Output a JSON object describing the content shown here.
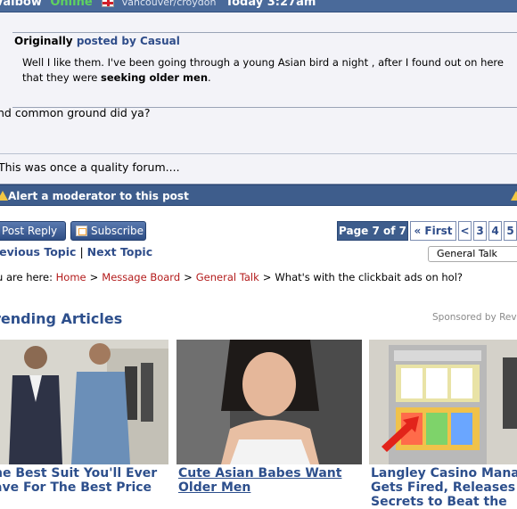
{
  "header": {
    "username": "Valbow",
    "status": "Online",
    "location": "vancouver/croydon",
    "time": "Today 3:27am"
  },
  "quote": {
    "label": "Originally",
    "posted_by": "posted by Casual",
    "line1": "Well I like them. I've been going through a young Asian bird a night , after I found out on here",
    "line2_pre": "that they were ",
    "line2_bold": "seeking older men",
    "line2_post": "."
  },
  "post": {
    "reply": "nd common ground did ya?",
    "signature": "This was once a quality forum...."
  },
  "alert": {
    "label": "Alert a moderator to this post"
  },
  "actions": {
    "post_reply": "Post Reply",
    "subscribe": "Subscribe"
  },
  "pager": {
    "label": "Page 7 of 7",
    "first": "« First",
    "prev": "<",
    "pages": [
      "3",
      "4",
      "5"
    ]
  },
  "topic_nav": {
    "previous": "revious Topic",
    "sep": "|",
    "next": "Next Topic"
  },
  "jump": {
    "selected": "General Talk"
  },
  "breadcrumb": {
    "prefix": "u are here:",
    "home": "Home",
    "board": "Message Board",
    "forum": "General Talk",
    "current": "What's with the clickbait ads on hol?"
  },
  "trending": {
    "title": "rending Articles",
    "sponsor": "Sponsored by Revc",
    "articles": [
      {
        "line1": "he Best Suit You'll Ever",
        "line2": "ave For The Best Price"
      },
      {
        "line1": "Cute Asian Babes Want",
        "line2": "Older Men"
      },
      {
        "line1": "Langley Casino Mana",
        "line2": "Gets Fired, Releases",
        "line3": "Secrets to Beat the"
      }
    ]
  },
  "colors": {
    "header_bar": "#4a6a9a",
    "accent_link": "#2d4f8c",
    "breadcrumb_link": "#b31b1b"
  }
}
